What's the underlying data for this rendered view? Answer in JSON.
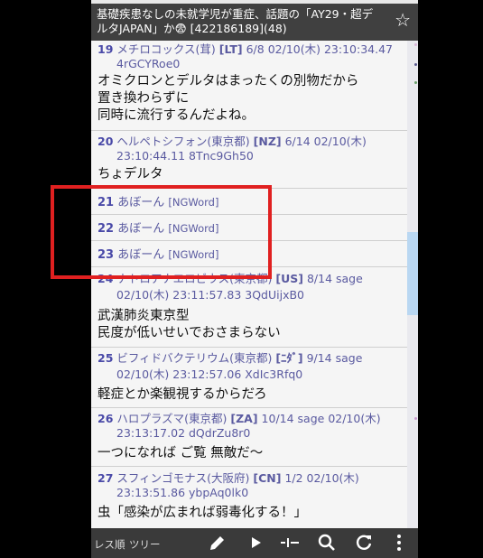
{
  "header": {
    "title": "基礎疾患なしの未就学児が重症、話題の「AY29・超デルタJAPAN」か😨 [422186189](48)"
  },
  "posts": [
    {
      "num": "19",
      "name": "メチロコックス(茸)",
      "flag": "[LT]",
      "count": "6/8",
      "datetime": "02/10(木) 23:10:34.47",
      "id": "4rGCYRoe0",
      "lines": [
        "オミクロンとデルタはまったくの別物だから",
        "置き換わらずに",
        "同時に流行するんだよね。"
      ]
    },
    {
      "num": "20",
      "name": "ヘルペトシフォン(東京都)",
      "flag": "[NZ]",
      "count": "6/14",
      "datetime": "02/10(木)",
      "line2": "23:10:44.11 8Tnc9Gh50",
      "lines": [
        "ちょデルタ"
      ]
    },
    {
      "num": "21",
      "name": "あぼーん",
      "tag": "[NGWord]"
    },
    {
      "num": "22",
      "name": "あぼーん",
      "tag": "[NGWord]"
    },
    {
      "num": "23",
      "name": "あぼーん",
      "tag": "[NGWord]"
    },
    {
      "num": "24",
      "name": "ナトロアナエロビウス(東京都)",
      "flag": "[US]",
      "count": "8/14 sage",
      "line2": "02/10(木) 23:11:57.83 3QdUijxB0",
      "lines": [
        "武漢肺炎東京型",
        "民度が低いせいでおさまらない"
      ]
    },
    {
      "num": "25",
      "name": "ビフィドバクテリウム(東京都)",
      "flag": "[ﾆﾀﾞ]",
      "count": "9/14 sage",
      "line2": "02/10(木) 23:12:57.06 XdIc3Rfq0",
      "lines": [
        "軽症とか楽観視するからだろ"
      ]
    },
    {
      "num": "26",
      "name": "ハロプラズマ(東京都)",
      "flag": "[ZA]",
      "count": "10/14 sage 02/10(木)",
      "line2": "23:13:17.02 dQdrZu8r0",
      "lines": [
        "一つになれば ご覧 無敵だ〜"
      ]
    },
    {
      "num": "27",
      "name": "スフィンゴモナス(大阪府)",
      "flag": "[CN]",
      "count": "1/2  02/10(木)",
      "line2": "23:13:51.86 ybpAq0lk0",
      "lines": [
        "虫「感染が広まれば弱毒化する！」"
      ]
    }
  ],
  "bottombar": {
    "res_order": "レス順",
    "tree": "ツリー",
    "icons": [
      "pencil-icon",
      "play-icon",
      "jump-icon",
      "search-icon",
      "refresh-icon",
      "more-icon"
    ]
  },
  "colors": {
    "header": "#404040",
    "meta": "#5a5aa0",
    "highlight": "#e02020",
    "thumb": "#b9d7f2"
  }
}
